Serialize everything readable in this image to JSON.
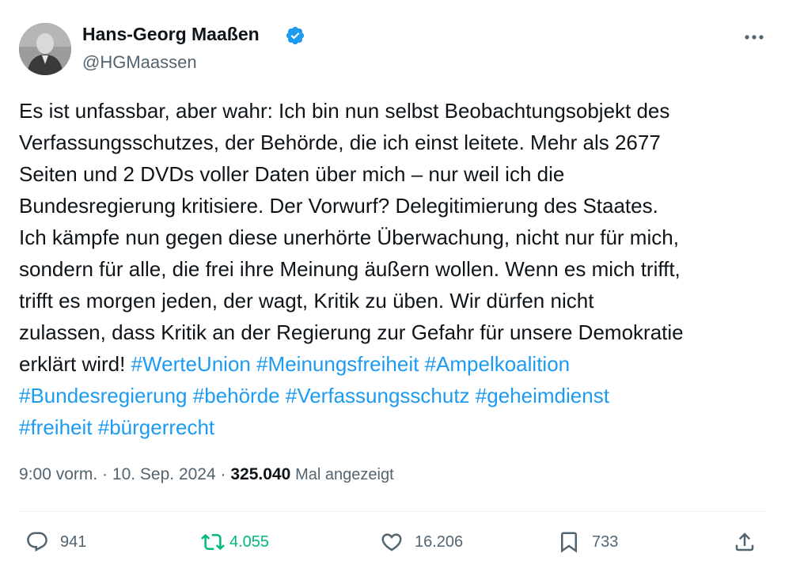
{
  "author": {
    "name": "Hans-Georg Maaßen",
    "handle": "@HGMaassen",
    "verified_icon": "verified-badge-icon"
  },
  "tweet": {
    "text": "Es ist unfassbar, aber wahr: Ich bin nun selbst Beobachtungsobjekt des\nVerfassungsschutzes, der Behörde, die ich einst leitete. Mehr als 2677\nSeiten und 2 DVDs voller Daten über mich – nur weil ich die\nBundesregierung kritisiere. Der Vorwurf? Delegitimierung des Staates.\nIch kämpfe nun gegen diese unerhörte Überwachung, nicht nur für mich,\nsondern für alle, die frei ihre Meinung äußern wollen. Wenn es mich trifft,\ntrifft es morgen jeden, der wagt, Kritik zu üben. Wir dürfen nicht\nzulassen, dass Kritik an der Regierung zur Gefahr für unsere Demokratie",
    "text_end": "erklärt wird!",
    "hashtags": [
      "#WerteUnion",
      "#Meinungsfreiheit",
      "#Ampelkoalition",
      "#Bundesregierung",
      "#behörde",
      "#Verfassungsschutz",
      "#geheimdienst",
      "#freiheit",
      "#bürgerrecht"
    ]
  },
  "meta": {
    "time": "9:00 vorm.",
    "separator": " · ",
    "date": "10. Sep. 2024",
    "views_count": "325.040",
    "views_label": "Mal angezeigt"
  },
  "actions": {
    "replies": "941",
    "reposts": "4.055",
    "likes": "16.206",
    "bookmarks": "733"
  },
  "colors": {
    "link": "#1d9bf0",
    "repost_active": "#00ba7c",
    "secondary_text": "#536471"
  }
}
